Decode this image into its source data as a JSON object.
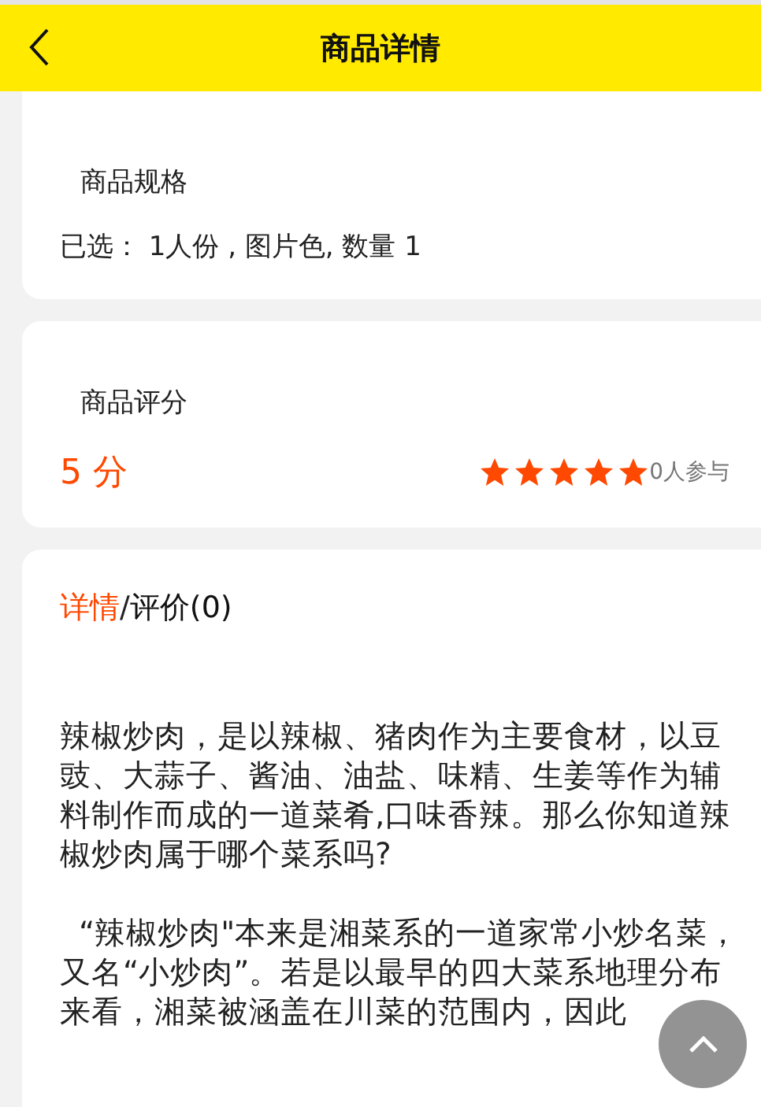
{
  "header": {
    "title": "商品详情"
  },
  "spec": {
    "title": "商品规格",
    "selected_text": "已选： 1人份 , 图片色, 数量 1"
  },
  "rating": {
    "title": "商品评分",
    "score": "5 分",
    "stars": 5,
    "participants": "0人参与"
  },
  "detail": {
    "tabs": [
      {
        "label": "详情",
        "selected": true
      },
      {
        "label": "评价(0)",
        "selected": false
      }
    ],
    "tab_separator": "/",
    "paragraphs": [
      "辣椒炒肉，是以辣椒、猪肉作为主要食材，以豆豉、大蒜子、酱油、油盐、味精、生姜等作为辅料制作而成的一道菜肴,口味香辣。那么你知道辣椒炒肉属于哪个菜系吗?",
      "“辣椒炒肉\"本来是湘菜系的一道家常小炒名菜，又名“小炒肉”。若是以最早的四大菜系地理分布来看，湘菜被涵盖在川菜的范围内，因此"
    ]
  }
}
